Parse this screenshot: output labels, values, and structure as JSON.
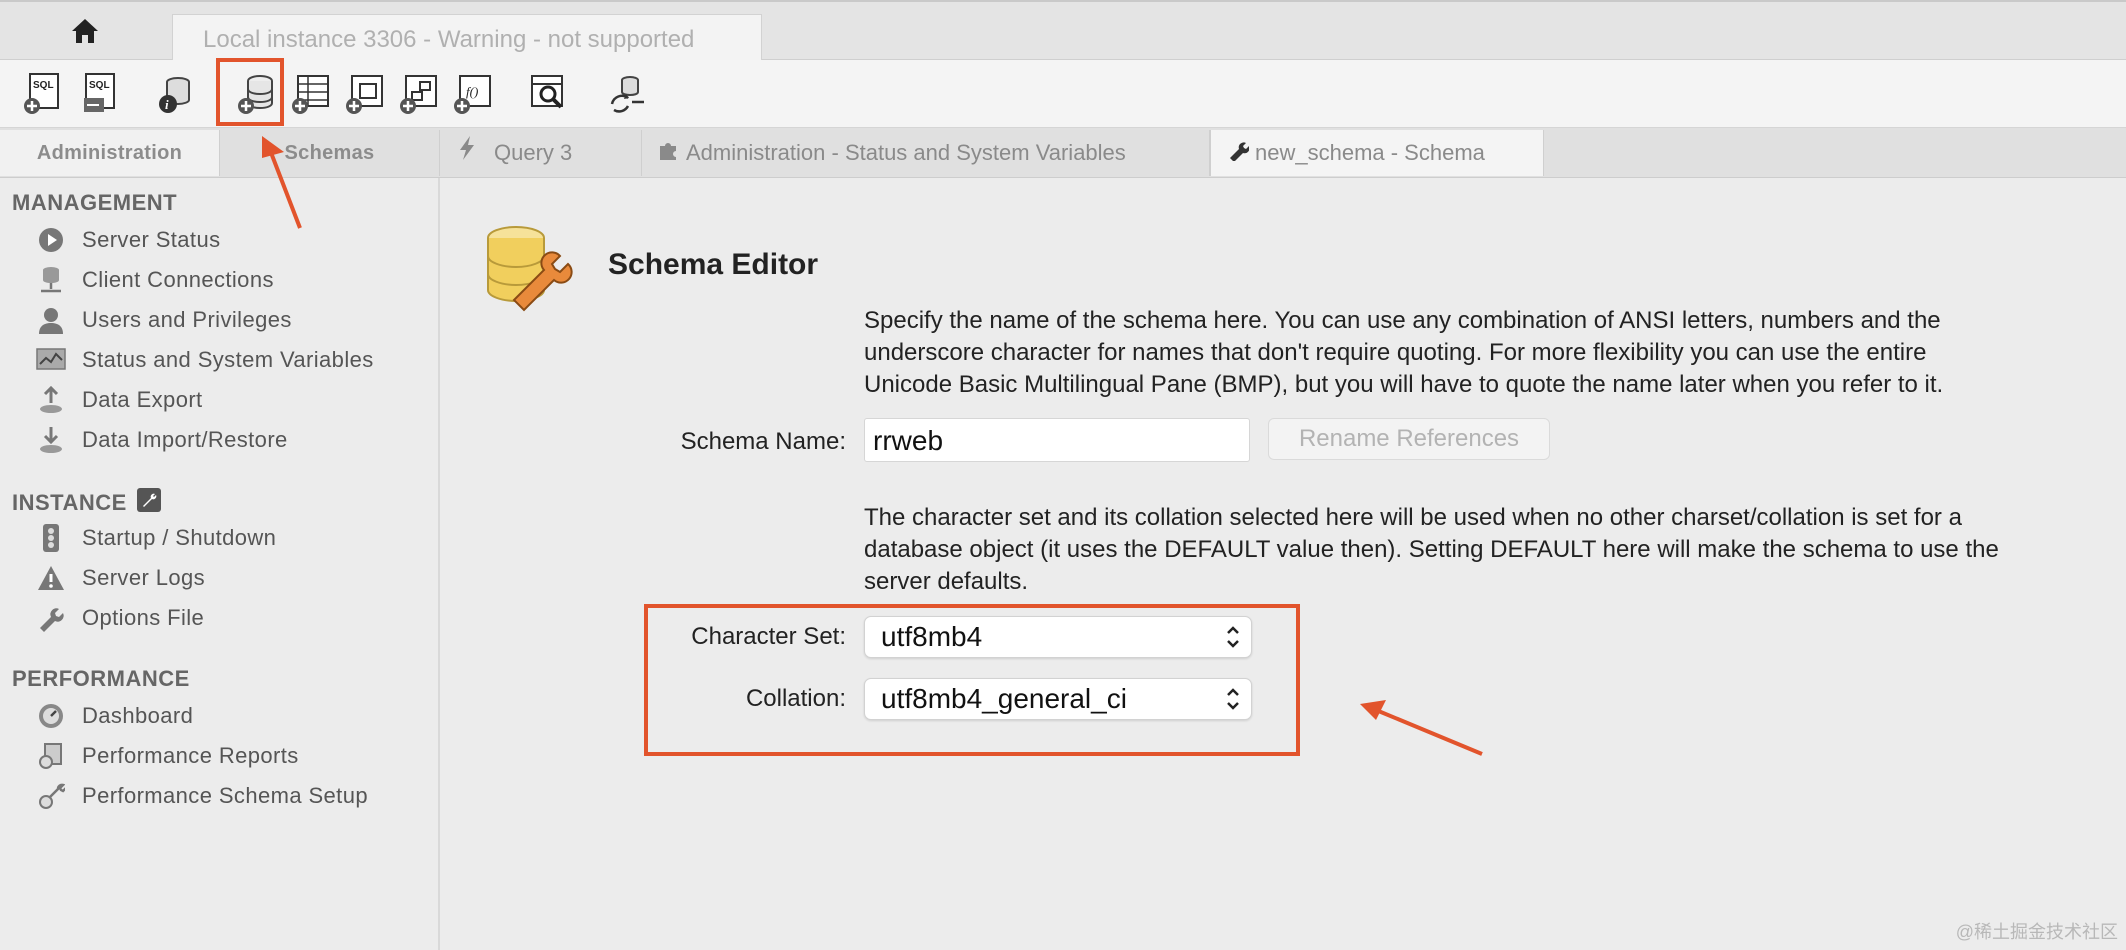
{
  "window": {
    "connection_tab": "Local instance 3306 - Warning - not supported"
  },
  "toolbar": {
    "icons": [
      "new-sql-tab-icon",
      "open-sql-script-icon",
      "schema-inspector-icon",
      "create-schema-icon",
      "create-table-icon",
      "create-view-icon",
      "create-procedure-icon",
      "create-function-icon",
      "search-table-data-icon",
      "reconnect-icon"
    ]
  },
  "tabs": {
    "sidebar": [
      "Administration",
      "Schemas"
    ],
    "documents": [
      {
        "icon": "lightning-icon",
        "label": "Query 3"
      },
      {
        "icon": "puzzle-icon",
        "label": "Administration - Status and System Variables"
      },
      {
        "icon": "wrench-icon",
        "label": "new_schema - Schema"
      }
    ]
  },
  "sidebar": {
    "management": {
      "title": "MANAGEMENT",
      "items": [
        "Server Status",
        "Client Connections",
        "Users and Privileges",
        "Status and System Variables",
        "Data Export",
        "Data Import/Restore"
      ]
    },
    "instance": {
      "title": "INSTANCE",
      "items": [
        "Startup / Shutdown",
        "Server Logs",
        "Options File"
      ]
    },
    "performance": {
      "title": "PERFORMANCE",
      "items": [
        "Dashboard",
        "Performance Reports",
        "Performance Schema Setup"
      ]
    }
  },
  "editor": {
    "title": "Schema Editor",
    "name_help": [
      "Specify the name of the schema here. You can use any combination of ANSI letters, numbers and the",
      "underscore character for names that don't require quoting. For more flexibility you can use the entire",
      "Unicode Basic Multilingual Pane (BMP), but you will have to quote the name later when you refer to it."
    ],
    "schema_name_label": "Schema Name:",
    "schema_name_value": "rrweb",
    "rename_button": "Rename References",
    "charset_help": [
      "The character set and its collation selected here will be used when no other charset/collation is set for a",
      "database object (it uses the DEFAULT value then). Setting DEFAULT here will make the schema to use the",
      "server defaults."
    ],
    "charset_label": "Character Set:",
    "charset_value": "utf8mb4",
    "collation_label": "Collation:",
    "collation_value": "utf8mb4_general_ci"
  },
  "annotations": {
    "color": "#e2542c"
  },
  "watermark": "@稀土掘金技术社区"
}
